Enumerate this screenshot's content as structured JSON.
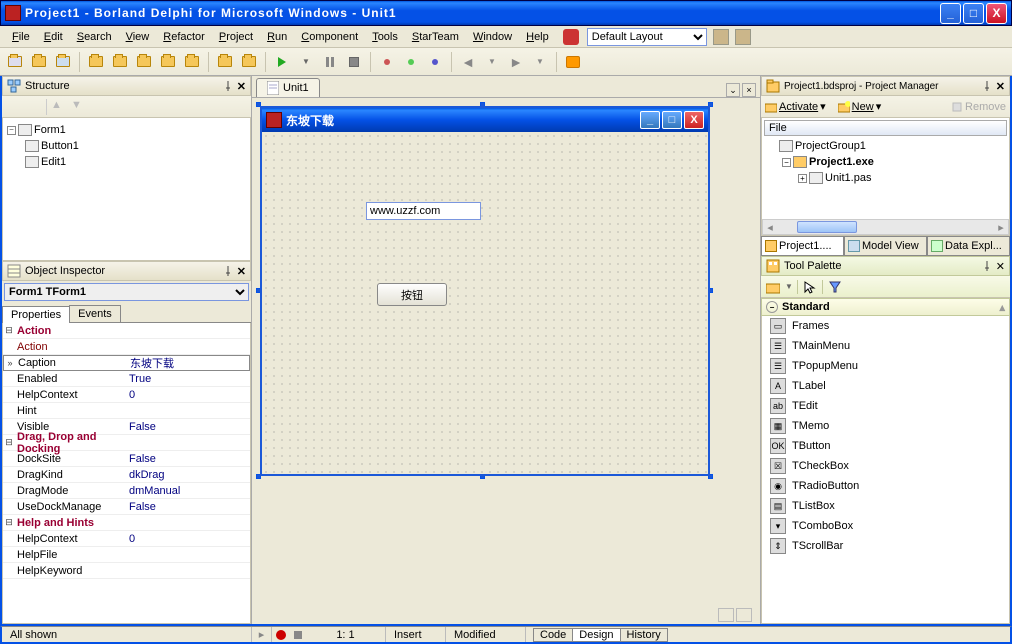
{
  "title": "Project1 - Borland Delphi for Microsoft Windows - Unit1",
  "menu": [
    "File",
    "Edit",
    "Search",
    "View",
    "Refactor",
    "Project",
    "Run",
    "Component",
    "Tools",
    "StarTeam",
    "Window",
    "Help"
  ],
  "layoutCombo": "Default Layout",
  "structure": {
    "title": "Structure",
    "root": "Form1",
    "children": [
      "Button1",
      "Edit1"
    ]
  },
  "objectInspector": {
    "title": "Object Inspector",
    "combo": "Form1",
    "comboType": "TForm1",
    "tabs": [
      "Properties",
      "Events"
    ],
    "rows": [
      {
        "type": "cat",
        "exp": "⊟",
        "name": "Action",
        "val": ""
      },
      {
        "type": "prop",
        "name": "Action",
        "val": "",
        "maroon": true
      },
      {
        "type": "prop",
        "name": "Caption",
        "val": "东坡下载",
        "sel": true,
        "exp": "»"
      },
      {
        "type": "prop",
        "name": "Enabled",
        "val": "True"
      },
      {
        "type": "prop",
        "name": "HelpContext",
        "val": "0"
      },
      {
        "type": "prop",
        "name": "Hint",
        "val": ""
      },
      {
        "type": "prop",
        "name": "Visible",
        "val": "False"
      },
      {
        "type": "cat",
        "exp": "⊟",
        "name": "Drag, Drop and Docking",
        "val": ""
      },
      {
        "type": "prop",
        "name": "DockSite",
        "val": "False"
      },
      {
        "type": "prop",
        "name": "DragKind",
        "val": "dkDrag"
      },
      {
        "type": "prop",
        "name": "DragMode",
        "val": "dmManual"
      },
      {
        "type": "prop",
        "name": "UseDockManage",
        "val": "False"
      },
      {
        "type": "cat",
        "exp": "⊟",
        "name": "Help and Hints",
        "val": ""
      },
      {
        "type": "prop",
        "name": "HelpContext",
        "val": "0"
      },
      {
        "type": "prop",
        "name": "HelpFile",
        "val": ""
      },
      {
        "type": "prop",
        "name": "HelpKeyword",
        "val": ""
      }
    ]
  },
  "centerTab": "Unit1",
  "form": {
    "caption": "东坡下载",
    "editValue": "www.uzzf.com",
    "buttonText": "按钮"
  },
  "projectManager": {
    "title": "Project1.bdsproj - Project Manager",
    "activateBtn": "Activate",
    "newBtn": "New",
    "removeBtn": "Remove",
    "header": "File",
    "rows": [
      {
        "indent": 0,
        "exp": "",
        "icon": "grp",
        "text": "ProjectGroup1"
      },
      {
        "indent": 1,
        "exp": "−",
        "icon": "exe",
        "text": "Project1.exe",
        "bold": true
      },
      {
        "indent": 2,
        "exp": "+",
        "icon": "pas",
        "text": "Unit1.pas"
      }
    ],
    "bottomTabs": [
      "Project1....",
      "Model View",
      "Data Expl..."
    ]
  },
  "toolPalette": {
    "title": "Tool Palette",
    "category": "Standard",
    "items": [
      "Frames",
      "TMainMenu",
      "TPopupMenu",
      "TLabel",
      "TEdit",
      "TMemo",
      "TButton",
      "TCheckBox",
      "TRadioButton",
      "TListBox",
      "TComboBox",
      "TScrollBar"
    ]
  },
  "status": {
    "left": "All shown",
    "pos": "1: 1",
    "insert": "Insert",
    "modified": "Modified",
    "tabs": [
      "Code",
      "Design",
      "History"
    ]
  }
}
